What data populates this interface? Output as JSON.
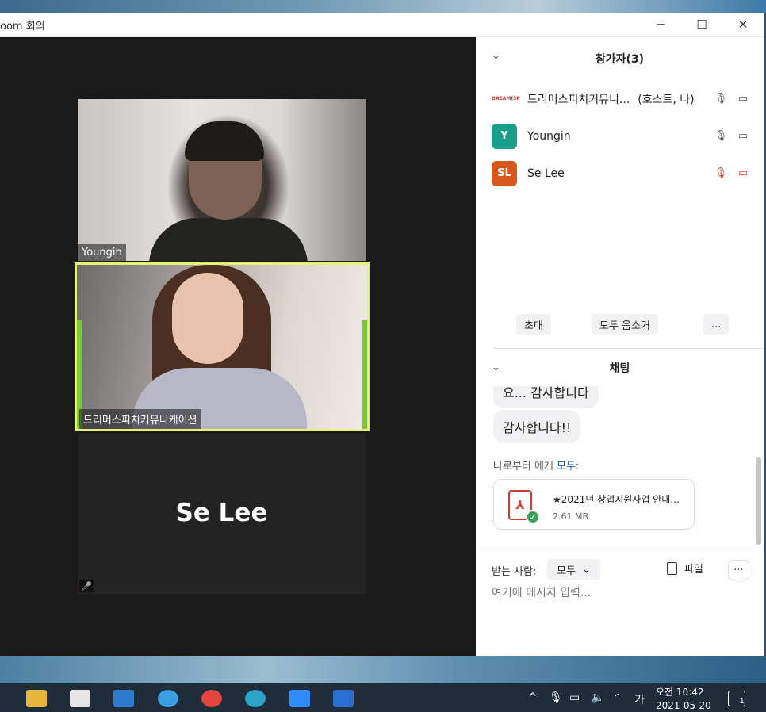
{
  "window": {
    "title": "oom 회의",
    "minimize_icon": "minimize-icon",
    "maximize_icon": "maximize-icon",
    "close_icon": "close-icon"
  },
  "videos": [
    {
      "name_tag": "Youngin"
    },
    {
      "name_tag": "드리머스피치커뮤니케이션",
      "active_speaker": true
    },
    {
      "display_name": "Se Lee",
      "muted": true
    }
  ],
  "participants_panel": {
    "title": "참가자(3)",
    "participants": [
      {
        "name": "드리머스피치커뮤니...",
        "role": "(호스트, 나)",
        "avatar_text": "DREAM(SP",
        "avatar_color": "#ffffff",
        "mic": "on",
        "video": "on"
      },
      {
        "name": "Youngin",
        "role": "",
        "avatar_text": "Y",
        "avatar_color": "#1a9e8c",
        "mic": "on",
        "video": "on"
      },
      {
        "name": "Se Lee",
        "role": "",
        "avatar_text": "SL",
        "avatar_color": "#d9571a",
        "mic": "muted",
        "video": "off"
      }
    ],
    "actions": {
      "invite": "초대",
      "mute_all": "모두 음소거",
      "more": "..."
    }
  },
  "chat": {
    "title": "채팅",
    "messages": [
      {
        "text": "요... 감사합니다"
      },
      {
        "text": "감사합니다!!"
      }
    ],
    "sender_prefix": "나로부터 에게",
    "recipient": "모두",
    "recipient_suffix": ":",
    "file": {
      "name": "★2021년 창업지원사업 안내...",
      "size": "2.61 MB"
    },
    "composer": {
      "to_label": "받는 사람:",
      "to_value": "모두",
      "file_button": "파일",
      "more": "···",
      "placeholder": "여기에 메시지 입력..."
    }
  },
  "taskbar": {
    "apps": [
      "file-explorer-icon",
      "store-icon",
      "mail-icon",
      "ie-icon",
      "chrome-icon",
      "edge-icon",
      "zoom-icon",
      "media-player-icon"
    ],
    "tray_ime": "가",
    "time": "오전 10:42",
    "date": "2021-05-20",
    "notification_count": "1"
  },
  "colors": {
    "active_speaker_border": "#e6f07a",
    "accent_link": "#0e62b8",
    "muted_red": "#e3483a"
  }
}
